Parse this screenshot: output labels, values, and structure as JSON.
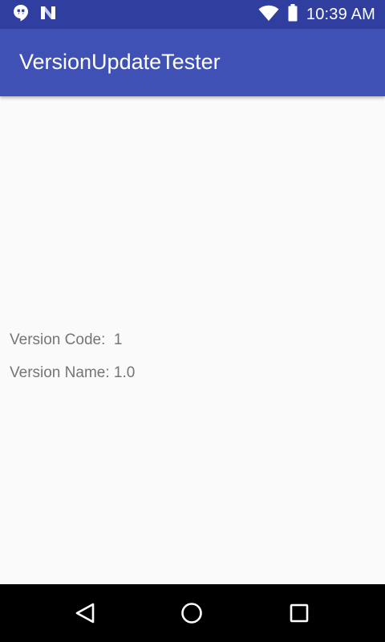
{
  "status_bar": {
    "time": "10:39 AM",
    "icons": [
      "hangouts-icon",
      "n-logo-icon",
      "wifi-icon",
      "battery-icon"
    ]
  },
  "app_bar": {
    "title": "VersionUpdateTester",
    "color": "#3f51b5"
  },
  "content": {
    "version_code_label": "Version Code:  1",
    "version_name_label": "Version Name: 1.0"
  },
  "nav_bar": {
    "buttons": [
      "back-icon",
      "home-icon",
      "recents-icon"
    ]
  },
  "colors": {
    "status_bar": "#303f9f",
    "app_bar": "#3f51b5",
    "background": "#fafafa",
    "text": "#757575"
  }
}
